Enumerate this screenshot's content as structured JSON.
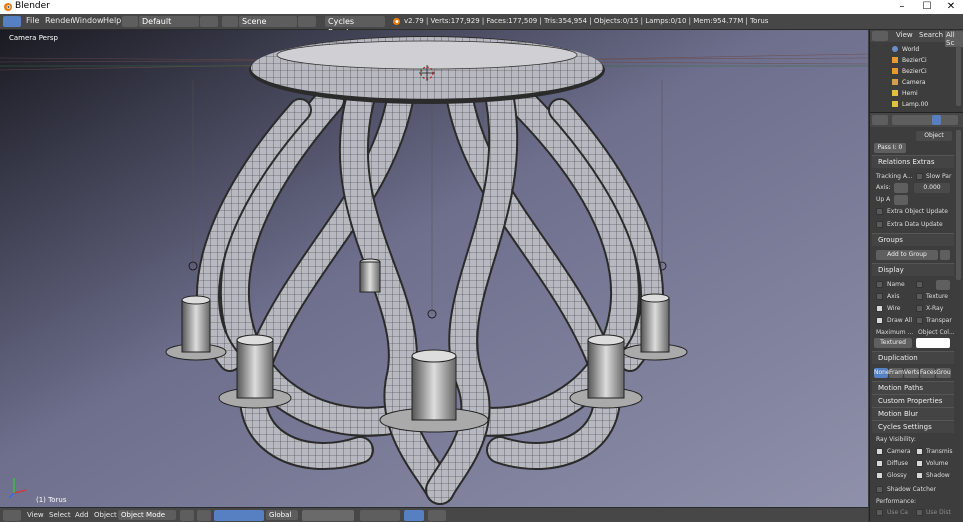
{
  "window": {
    "title": "Blender",
    "controls": {
      "minimize": "–",
      "maximize": "☐",
      "close": "✕"
    }
  },
  "menubar": {
    "menus": [
      "File",
      "Render",
      "Window",
      "Help"
    ],
    "layout": "Default",
    "scene": "Scene",
    "engine": "Cycles Render",
    "status": "v2.79 | Verts:177,929 | Faces:177,509 | Tris:354,954 | Objects:0/15 | Lamps:0/10 | Mem:954.77M | Torus"
  },
  "viewport": {
    "view_label": "Camera Persp",
    "object_label": "(1) Torus"
  },
  "footer": {
    "menus": [
      "View",
      "Select",
      "Add",
      "Object"
    ],
    "mode": "Object Mode",
    "orientation": "Global"
  },
  "outliner": {
    "header": {
      "view": "View",
      "search": "Search",
      "scenes": "All Sc"
    },
    "items": [
      "World",
      "BezierCi",
      "BezierCi",
      "Camera",
      "Hemi",
      "Lamp.00"
    ]
  },
  "properties": {
    "object_dropdown": "Object",
    "pass_index": "Pass I: 0",
    "relations_extras": {
      "title": "Relations Extras",
      "tracking": "Tracking A...",
      "slow_par": "Slow Par",
      "axis_label": "Axis:",
      "axis_value": "0.000",
      "up_axis_label": "Up A",
      "extra_object_update": "Extra Object Update",
      "extra_data_update": "Extra Data Update"
    },
    "groups": {
      "title": "Groups",
      "add_button": "Add to Group"
    },
    "display": {
      "title": "Display",
      "name": "Name",
      "axis": "Axis",
      "texture": "Texture",
      "wire": "Wire",
      "xray": "X-Ray",
      "draw_all": "Draw All",
      "transparent": "Transpar",
      "maximum": "Maximum ...",
      "object_color": "Object Col...",
      "draw_type": "Textured"
    },
    "duplication": {
      "title": "Duplication",
      "options": [
        "None",
        "Fram",
        "Verts",
        "Faces",
        "Grou"
      ],
      "selected": "None"
    },
    "motion_paths": "Motion Paths",
    "custom_properties": "Custom Properties",
    "motion_blur": "Motion Blur",
    "cycles_settings": {
      "title": "Cycles Settings",
      "ray_visibility": "Ray Visibility:",
      "camera": "Camera",
      "transmission": "Transmis",
      "diffuse": "Diffuse",
      "volume": "Volume",
      "glossy": "Glossy",
      "shadow": "Shadow",
      "shadow_catcher": "Shadow Catcher",
      "performance": "Performance:",
      "use_ca": "Use Ca",
      "use_dist": "Use Dist"
    }
  },
  "colors": {
    "accent": "#5680c2",
    "viewport_bg": "#7a7c99",
    "panel_bg": "#3d3d3d",
    "header_bg": "#474747"
  }
}
